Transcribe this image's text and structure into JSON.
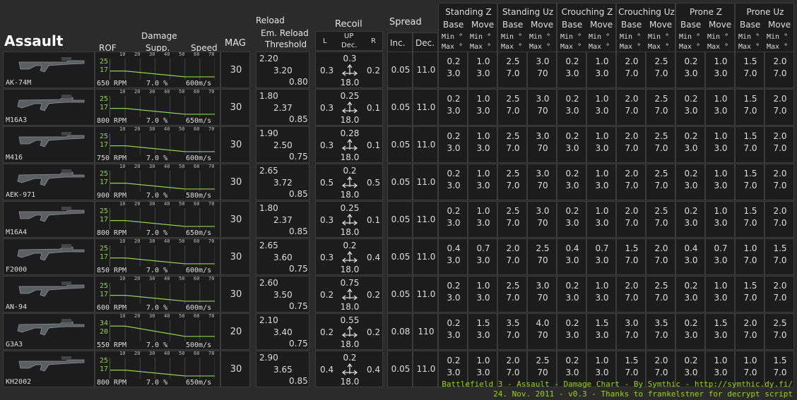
{
  "title": "Assault",
  "headers": {
    "damage": "Damage",
    "rof": "ROF",
    "supp": "Supp.",
    "speed": "Speed",
    "mag": "MAG",
    "reload": "Reload",
    "em_reload": "Em. Reload",
    "threshold": "Threshold",
    "recoil": "Recoil",
    "l": "L",
    "up": "UP",
    "dec": "Dec.",
    "r": "R",
    "spread": "Spread",
    "inc": "Inc.",
    "spread_dec": "Dec.",
    "base": "Base",
    "move": "Move",
    "min": "Min °",
    "max": "Max °",
    "ticks": [
      "10",
      "20",
      "30",
      "40",
      "50",
      "60",
      "70"
    ],
    "rpm": "RPM"
  },
  "stances": [
    "Standing Z",
    "Standing Uz",
    "Crouching Z",
    "Crouching Uz",
    "Prone Z",
    "Prone Uz"
  ],
  "colors": {
    "green": "#8fd14f",
    "bg": "#2b2b2b",
    "cell": "#1c1c1c",
    "footer": "#9bd300"
  },
  "weapons": [
    {
      "name": "AK-74M",
      "dmg_max": "25",
      "dmg_min": "17",
      "rof": "650",
      "supp": "7.0 %",
      "speed": "600m/s",
      "mag": "30",
      "reload": "2.20",
      "em_reload": "3.20",
      "threshold": "0.80",
      "rec_l": "0.3",
      "rec_up": "0.3",
      "rec_dec": "18.0",
      "rec_r": "0.2",
      "inc": "0.05",
      "sdec": "11.0",
      "spread": [
        [
          "0.2",
          "1.0",
          "2.5",
          "3.0",
          "0.2",
          "1.0",
          "2.0",
          "2.5",
          "0.2",
          "1.0",
          "1.5",
          "2.0"
        ],
        [
          "3.0",
          "3.0",
          "7.0",
          "70",
          "3.0",
          "3.0",
          "7.0",
          "7.0",
          "3.0",
          "3.0",
          "7.0",
          "7.0"
        ]
      ]
    },
    {
      "name": "M16A3",
      "dmg_max": "25",
      "dmg_min": "17",
      "rof": "800",
      "supp": "7.0 %",
      "speed": "650m/s",
      "mag": "30",
      "reload": "1.80",
      "em_reload": "2.37",
      "threshold": "0.85",
      "rec_l": "0.3",
      "rec_up": "0.25",
      "rec_dec": "18.0",
      "rec_r": "0.1",
      "inc": "0.05",
      "sdec": "11.0",
      "spread": [
        [
          "0.2",
          "1.0",
          "2.5",
          "3.0",
          "0.2",
          "1.0",
          "2.0",
          "2.5",
          "0.2",
          "1.0",
          "1.5",
          "2.0"
        ],
        [
          "3.0",
          "3.0",
          "7.0",
          "70",
          "3.0",
          "3.0",
          "7.0",
          "7.0",
          "3.0",
          "3.0",
          "7.0",
          "7.0"
        ]
      ]
    },
    {
      "name": "M416",
      "dmg_max": "25",
      "dmg_min": "17",
      "rof": "750",
      "supp": "7.0 %",
      "speed": "600m/s",
      "mag": "30",
      "reload": "1.90",
      "em_reload": "2.50",
      "threshold": "0.75",
      "rec_l": "0.3",
      "rec_up": "0.28",
      "rec_dec": "18.0",
      "rec_r": "0.1",
      "inc": "0.05",
      "sdec": "11.0",
      "spread": [
        [
          "0.2",
          "1.0",
          "2.5",
          "3.0",
          "0.2",
          "1.0",
          "2.0",
          "2.5",
          "0.2",
          "1.0",
          "1.5",
          "2.0"
        ],
        [
          "3.0",
          "3.0",
          "7.0",
          "70",
          "3.0",
          "3.0",
          "7.0",
          "7.0",
          "3.0",
          "3.0",
          "7.0",
          "7.0"
        ]
      ]
    },
    {
      "name": "AEK-971",
      "dmg_max": "25",
      "dmg_min": "17",
      "rof": "900",
      "supp": "7.0 %",
      "speed": "580m/s",
      "mag": "30",
      "reload": "2.65",
      "em_reload": "3.72",
      "threshold": "0.85",
      "rec_l": "0.5",
      "rec_up": "0.2",
      "rec_dec": "18.0",
      "rec_r": "0.5",
      "inc": "0.05",
      "sdec": "11.0",
      "spread": [
        [
          "0.2",
          "1.0",
          "2.5",
          "3.0",
          "0.2",
          "1.0",
          "2.0",
          "2.5",
          "0.2",
          "1.0",
          "1.5",
          "2.0"
        ],
        [
          "3.0",
          "3.0",
          "7.0",
          "70",
          "3.0",
          "3.0",
          "7.0",
          "7.0",
          "3.0",
          "3.0",
          "7.0",
          "7.0"
        ]
      ]
    },
    {
      "name": "M16A4",
      "dmg_max": "25",
      "dmg_min": "17",
      "rof": "800",
      "supp": "7.0 %",
      "speed": "650m/s",
      "mag": "30",
      "reload": "1.80",
      "em_reload": "2.37",
      "threshold": "0.85",
      "rec_l": "0.3",
      "rec_up": "0.25",
      "rec_dec": "18.0",
      "rec_r": "0.1",
      "inc": "0.05",
      "sdec": "11.0",
      "spread": [
        [
          "0.2",
          "1.0",
          "2.5",
          "3.0",
          "0.2",
          "1.0",
          "2.0",
          "2.5",
          "0.2",
          "1.0",
          "1.5",
          "2.0"
        ],
        [
          "3.0",
          "3.0",
          "7.0",
          "70",
          "3.0",
          "3.0",
          "7.0",
          "7.0",
          "3.0",
          "3.0",
          "7.0",
          "7.0"
        ]
      ]
    },
    {
      "name": "F2000",
      "dmg_max": "25",
      "dmg_min": "17",
      "rof": "850",
      "supp": "7.0 %",
      "speed": "600m/s",
      "mag": "30",
      "reload": "2.65",
      "em_reload": "3.60",
      "threshold": "0.75",
      "rec_l": "0.3",
      "rec_up": "0.2",
      "rec_dec": "18.0",
      "rec_r": "0.4",
      "inc": "0.05",
      "sdec": "11.0",
      "spread": [
        [
          "0.4",
          "0.7",
          "2.0",
          "2.5",
          "0.4",
          "0.7",
          "1.5",
          "2.0",
          "0.4",
          "0.7",
          "1.0",
          "1.5"
        ],
        [
          "3.0",
          "3.0",
          "7.0",
          "70",
          "3.0",
          "3.0",
          "7.0",
          "7.0",
          "3.0",
          "3.0",
          "7.0",
          "7.0"
        ]
      ]
    },
    {
      "name": "AN-94",
      "dmg_max": "25",
      "dmg_min": "17",
      "rof": "600",
      "supp": "7.0 %",
      "speed": "600m/s",
      "mag": "30",
      "reload": "2.60",
      "em_reload": "3.50",
      "threshold": "0.75",
      "rec_l": "0.2",
      "rec_up": "0.75",
      "rec_dec": "18.0",
      "rec_r": "0.2",
      "inc": "0.05",
      "sdec": "11.0",
      "spread": [
        [
          "0.2",
          "1.0",
          "2.5",
          "3.0",
          "0.2",
          "1.0",
          "2.0",
          "2.5",
          "0.2",
          "1.0",
          "1.5",
          "2.0"
        ],
        [
          "3.0",
          "3.0",
          "7.0",
          "70",
          "3.0",
          "3.0",
          "7.0",
          "7.0",
          "3.0",
          "3.0",
          "7.0",
          "7.0"
        ]
      ]
    },
    {
      "name": "G3A3",
      "dmg_max": "34",
      "dmg_min": "20",
      "rof": "550",
      "supp": "7.0 %",
      "speed": "500m/s",
      "mag": "20",
      "reload": "2.10",
      "em_reload": "3.40",
      "threshold": "0.75",
      "rec_l": "0.2",
      "rec_up": "0.55",
      "rec_dec": "18.0",
      "rec_r": "0.2",
      "inc": "0.08",
      "sdec": "110",
      "spread": [
        [
          "0.2",
          "1.5",
          "3.5",
          "4.0",
          "0.2",
          "1.5",
          "3.0",
          "3.5",
          "0.2",
          "1.5",
          "2.0",
          "2.5"
        ],
        [
          "3.0",
          "3.0",
          "7.0",
          "70",
          "3.0",
          "3.0",
          "7.0",
          "7.0",
          "3.0",
          "3.0",
          "7.0",
          "7.0"
        ]
      ]
    },
    {
      "name": "KH2002",
      "dmg_max": "25",
      "dmg_min": "17",
      "rof": "800",
      "supp": "7.0 %",
      "speed": "650m/s",
      "mag": "30",
      "reload": "2.90",
      "em_reload": "3.65",
      "threshold": "0.85",
      "rec_l": "0.4",
      "rec_up": "0.2",
      "rec_dec": "18.0",
      "rec_r": "0.4",
      "inc": "0.05",
      "sdec": "11.0",
      "spread": [
        [
          "0.2",
          "1.0",
          "2.0",
          "2.5",
          "0.2",
          "1.0",
          "1.5",
          "2.0",
          "0.2",
          "1.0",
          "1.0",
          "1.5"
        ],
        [
          "3.0",
          "3.0",
          "7.0",
          "70",
          "3.0",
          "3.0",
          "7.0",
          "7.0",
          "3.0",
          "3.0",
          "7.0",
          "7.0"
        ]
      ]
    }
  ],
  "chart_data": {
    "type": "line",
    "x": [
      0,
      10,
      20,
      30,
      40,
      50,
      60,
      70
    ],
    "series": [
      {
        "values": [
          25,
          25,
          23.4,
          21.8,
          20.2,
          18.6,
          17,
          17
        ]
      },
      {
        "values": [
          34,
          34,
          31.2,
          28.4,
          25.6,
          22.8,
          20,
          20
        ]
      }
    ]
  },
  "footer": {
    "line1": "Battlefield 3 - Assault - Damage Chart - By Symthic - http://symthic.dy.fi/",
    "line2": "24. Nov. 2011 - v0.3 - Thanks to frankelstner for decrypt script"
  }
}
